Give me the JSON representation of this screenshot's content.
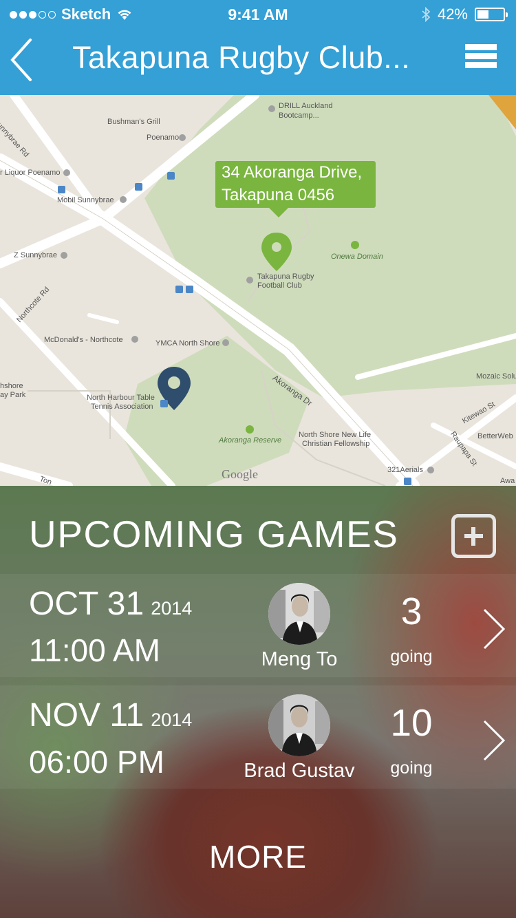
{
  "status_bar": {
    "carrier": "Sketch",
    "time": "9:41 AM",
    "battery": "42%",
    "signal_icon": "signal-dots-icon",
    "wifi_icon": "wifi-icon",
    "bluetooth_icon": "bluetooth-icon"
  },
  "nav": {
    "title": "Takapuna Rugby Club...",
    "back_icon": "chevron-left-icon",
    "menu_icon": "hamburger-menu-icon",
    "accent": "#34a0d6"
  },
  "map": {
    "callout_line1": "34 Akoranga Drive,",
    "callout_line2": "Takapuna 0456",
    "callout_color": "#7ab53f",
    "labels": {
      "drill": "DRILL Auckland",
      "drill2": "Bootcamp...",
      "bushman": "Bushman's Grill",
      "poenamo": "Poenamo",
      "liquor": "r Liquor Poenamo",
      "mobil": "Mobil Sunnybrae",
      "sunnybrae_rd": "unnybrae Rd",
      "z": "Z Sunnybrae",
      "northcote": "Northcote Rd",
      "onewa": "Onewa Domain",
      "club1": "Takapuna Rugby",
      "club2": "Football Club",
      "mcd": "McDonald's - Northcote",
      "ymca": "YMCA North Shore",
      "akoranga_dr": "Akoranga Dr",
      "nh1": "North Harbour Table",
      "nh2": "Tennis Association",
      "shore1": "hshore",
      "shore2": "ay Park",
      "akoranga_res": "Akoranga Reserve",
      "nsnl1": "North Shore New Life",
      "nsnl2": "Christian Fellowship",
      "mozaic": "Mozaic Solu",
      "kitewao": "Kitewao St",
      "raupapa": "Raupapa St",
      "betterweb": "BetterWeb",
      "aerials": "321Aerials",
      "awa": "Awa",
      "ton": "Ton",
      "google": "Google"
    }
  },
  "upcoming": {
    "title": "UPCOMING GAMES",
    "add_icon": "plus-square-icon",
    "games": [
      {
        "date": "OCT 31",
        "year": "2014",
        "time": "11:00 AM",
        "host": "Meng To",
        "count": "3",
        "going": "going"
      },
      {
        "date": "NOV 11",
        "year": "2014",
        "time": "06:00 PM",
        "host": "Brad Gustav",
        "count": "10",
        "going": "going"
      }
    ],
    "more": "MORE"
  }
}
